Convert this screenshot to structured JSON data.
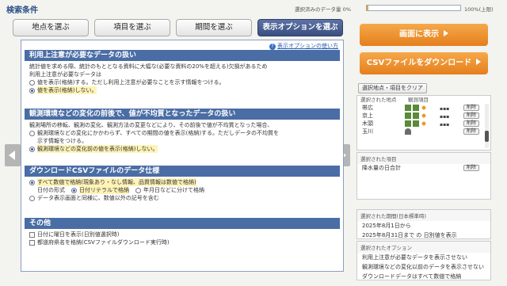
{
  "header": {
    "title": "検索条件",
    "data_amount_label": "選択済みのデータ量 0%",
    "data_amount_fraction": 0.02,
    "data_amount_max": "100%(上限)"
  },
  "tabs": [
    {
      "label": "地点を選ぶ"
    },
    {
      "label": "項目を選ぶ"
    },
    {
      "label": "期間を選ぶ"
    },
    {
      "label": "表示オプションを選ぶ"
    }
  ],
  "help_link": "表示オプションの使い方",
  "sections": {
    "caution": {
      "title": "利用上注意が必要なデータの扱い",
      "desc1": "統計値を求める際、統計のもととなる資料に大幅な(必要な資料の20%を超える)欠損があるため",
      "desc2": "利用上注意が必要なデータは",
      "opt1": "値を表示(格納)する。ただし利用上注意が必要なことを示す情報をつける。",
      "opt2": "値を表示(格納)しない。"
    },
    "env": {
      "title": "観測環境などの変化の前後で、値が不均質となったデータの扱い",
      "desc": "観測場所の移転、観測の変化、観測方法の変更などにより、その前後で値が不均質となった場合、",
      "opt1": "観測環境などの変化にかかわらず、すべての期間の値を表示(格納)する。ただしデータの不均質を",
      "opt1b": "示す情報をつける。",
      "opt2": "観測環境などの変化前の値を表示(格納)しない。"
    },
    "csv": {
      "title": "ダウンロードCSVファイルのデータ仕様",
      "opt1": "すべて数値で格納(現象あり・なし情報、品質情報は数値で格納)",
      "date_label": "日付の形式",
      "date_opt1": "日付リテラルで格納",
      "date_opt2": "年月日などに分けて格納",
      "opt2": "データ表示画面と同様に、数値以外の記号を含む"
    },
    "other": {
      "title": "その他",
      "opt1": "日付に曜日を表示(日別値選択時)",
      "opt2": "都道府県名を格納(CSVファイルダウンロード実行時)"
    }
  },
  "right": {
    "show_button": "画面に表示",
    "csv_button": "CSVファイルをダウンロード",
    "clear_button": "選択地点・項目をクリア",
    "points_label": "選択された地点",
    "points_col2": "観測項目",
    "points": [
      {
        "name": "帯広",
        "delete": "削除"
      },
      {
        "name": "京上",
        "delete": "削除"
      },
      {
        "name": "木頭",
        "delete": "削除"
      },
      {
        "name": "玉川",
        "delete": "削除"
      }
    ],
    "items_label": "選択された項目",
    "items": [
      {
        "name": "降水量の日合計",
        "delete": "削除"
      }
    ],
    "period_label": "選択された期間(日本標準時)",
    "period_line1": "2025年8月1日から",
    "period_line2": "2025年8月31日まで の 日別値を表示",
    "options_label": "選択されたオプション",
    "options": [
      "利用上注意が必要なデータを表示させない",
      "観測環境などの変化以前のデータを表示させない",
      "ダウンロードデータはすべて数値で格納"
    ]
  },
  "colors": {
    "accent_orange": "#e88e2a",
    "header_blue": "#4a6da5",
    "highlight": "#fff4b8"
  }
}
